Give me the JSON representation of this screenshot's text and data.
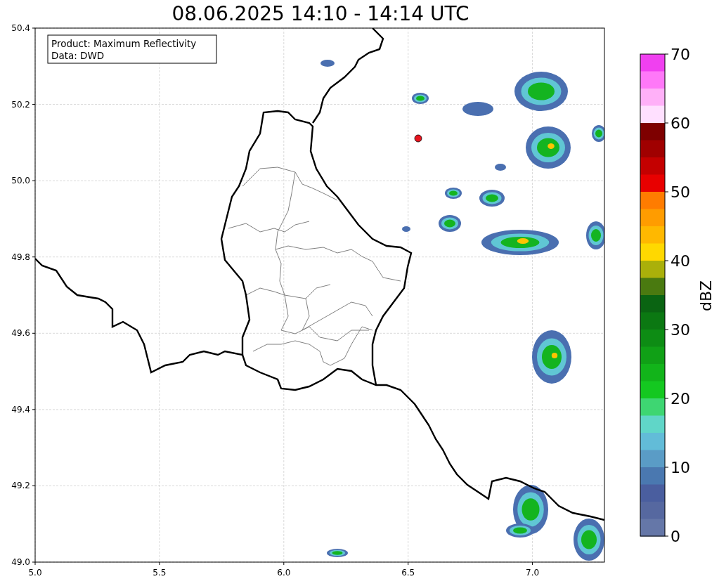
{
  "title": "08.06.2025 14:10 - 14:14 UTC",
  "info_box": {
    "lines": [
      "Product: Maximum Reflectivity",
      "Data: DWD"
    ]
  },
  "map": {
    "x_ticks": [
      "5.0",
      "5.5",
      "6.0",
      "6.5",
      "7.0"
    ],
    "y_ticks": [
      "50.4",
      "50.2",
      "50.0",
      "49.8",
      "49.6",
      "49.4",
      "49.2",
      "49.0"
    ]
  },
  "colorbar": {
    "ticks": [
      "70",
      "60",
      "50",
      "40",
      "30",
      "20",
      "10",
      "0"
    ],
    "label": "dBZ",
    "segments": [
      {
        "color": "#f040f0"
      },
      {
        "color": "#ff78f8"
      },
      {
        "color": "#ffb0f8"
      },
      {
        "color": "#ffe0ff"
      },
      {
        "color": "#7e0000"
      },
      {
        "color": "#a00000"
      },
      {
        "color": "#c40000"
      },
      {
        "color": "#e80000"
      },
      {
        "color": "#ff7c00"
      },
      {
        "color": "#ff9c00"
      },
      {
        "color": "#ffb800"
      },
      {
        "color": "#ffd800"
      },
      {
        "color": "#aab00a"
      },
      {
        "color": "#4a7a10"
      },
      {
        "color": "#0a6412"
      },
      {
        "color": "#0b7812"
      },
      {
        "color": "#0d8c14"
      },
      {
        "color": "#10a016"
      },
      {
        "color": "#12b41a"
      },
      {
        "color": "#14c820"
      },
      {
        "color": "#3ed672"
      },
      {
        "color": "#60d6c8"
      },
      {
        "color": "#62bcd8"
      },
      {
        "color": "#5a9cc6"
      },
      {
        "color": "#4a78b0"
      },
      {
        "color": "#4a5e9f"
      },
      {
        "color": "#5668a0"
      },
      {
        "color": "#6577a8"
      }
    ]
  }
}
